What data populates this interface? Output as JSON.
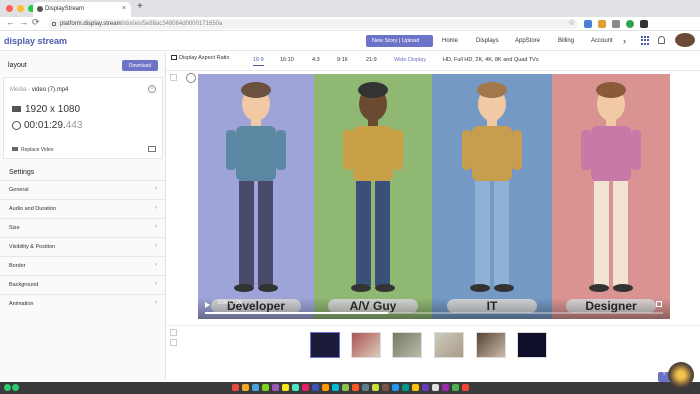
{
  "browser": {
    "tab_title": "DisplayStream",
    "tab_close": "×",
    "new_tab": "+",
    "back": "←",
    "forward": "→",
    "reload": "⟳",
    "url_host": "platform.display.stream",
    "url_path": "/stories/5e88ac348064d0000171650a",
    "star": "☆"
  },
  "app": {
    "logo": "display stream",
    "new_story_label": "New Story | Upload",
    "nav": [
      "Home",
      "Displays",
      "AppStore",
      "Billing",
      "Account"
    ],
    "nav_more": "›"
  },
  "left_panel": {
    "title": "layout",
    "download_label": "Download",
    "media_prefix": "Media -",
    "media_name": "video (7).mp4",
    "resolution": "1920 x 1080",
    "duration_main": "00:01:29.",
    "duration_ms": "443",
    "replace_label": "Replace Video",
    "settings_heading": "Settings",
    "settings_items": [
      "General",
      "Audio and Duration",
      "Size",
      "Visibility & Position",
      "Border",
      "Background",
      "Animation"
    ],
    "chevron": "›"
  },
  "toolbar": {
    "aspect_label": "Display Aspect Ratio",
    "ratios": [
      "16:9",
      "16:10",
      "4:3",
      "9:16",
      "21:9"
    ],
    "wide_display": "Wide Display",
    "resolution_note": "HD, Full HD, 2K, 4K, 8K and Quad TVs"
  },
  "video": {
    "panels": [
      {
        "label": "Developer",
        "color": "#9ea3d8"
      },
      {
        "label": "A/V Guy",
        "color": "#8fb873"
      },
      {
        "label": "IT",
        "color": "#7399c4"
      },
      {
        "label": "Designer",
        "color": "#d99391"
      }
    ],
    "time_text": "0:36 / 1:29",
    "progress": 0.4
  },
  "colors": {
    "accent": "#6c73c8",
    "logo": "#4a5cab"
  }
}
